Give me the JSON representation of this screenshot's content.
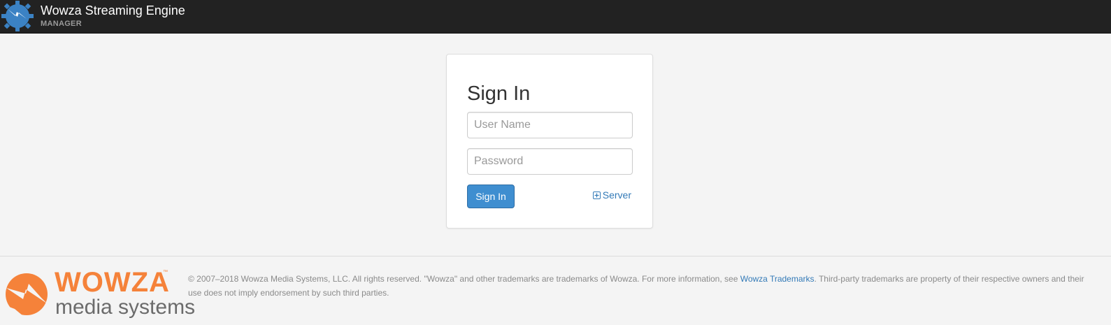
{
  "header": {
    "title": "Wowza Streaming Engine",
    "subtitle": "MANAGER",
    "logo_icon": "wowza-bolt-gear-icon"
  },
  "signin": {
    "heading": "Sign In",
    "username_placeholder": "User Name",
    "username_value": "",
    "password_placeholder": "Password",
    "password_value": "",
    "submit_label": "Sign In",
    "server_link_label": "Server",
    "server_link_icon": "plus-square-icon"
  },
  "footer": {
    "brand_word": "WOWZA",
    "brand_tm": "™",
    "brand_sub": "media systems",
    "copyright_before_link": "© 2007–2018 Wowza Media Systems, LLC. All rights reserved. \"Wowza\" and other trademarks are trademarks of Wowza. For more information, see ",
    "trademarks_link": "Wowza Trademarks",
    "copyright_after_link": ". Third-party trademarks are property of their respective owners and their use does not imply endorsement by such third parties."
  },
  "colors": {
    "topbar": "#222222",
    "accent_blue": "#3f8ed0",
    "link_blue": "#337ab7",
    "brand_orange": "#f5823a",
    "background": "#f4f4f4"
  }
}
